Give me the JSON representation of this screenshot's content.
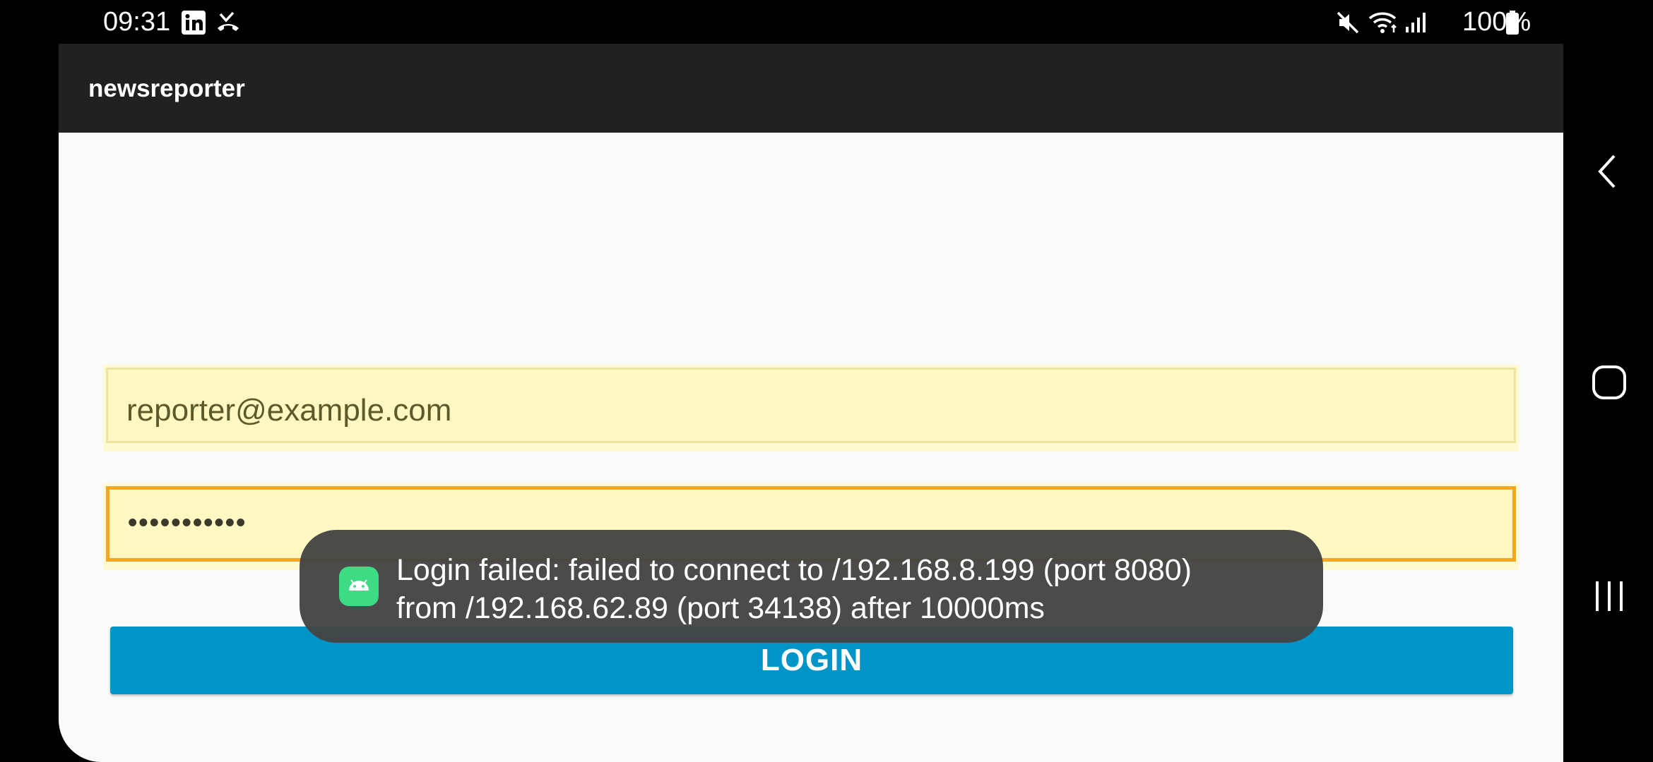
{
  "status_bar": {
    "time": "09:31",
    "battery": "100%",
    "icons": [
      "linkedin-icon",
      "missed-call-icon",
      "mute-icon",
      "wifi-icon",
      "signal-icon",
      "battery-icon"
    ]
  },
  "app": {
    "title": "newsreporter"
  },
  "form": {
    "email_value": "reporter@example.com",
    "password_value": "•••••••••••",
    "login_label": "LOGIN"
  },
  "toast": {
    "line1": "Login failed: failed to connect to /192.168.8.199 (port 8080)",
    "line2": "from /192.168.62.89 (port 34138) after 10000ms",
    "icon": "android-icon"
  },
  "nav_bar": {
    "icons": [
      "back-icon",
      "home-icon",
      "recents-icon"
    ]
  },
  "colors": {
    "toolbar": "#212121",
    "login_button": "#0095c9",
    "field_bg": "#fff8c2",
    "focus_border": "#f5a623",
    "toast_bg": "#444444"
  }
}
